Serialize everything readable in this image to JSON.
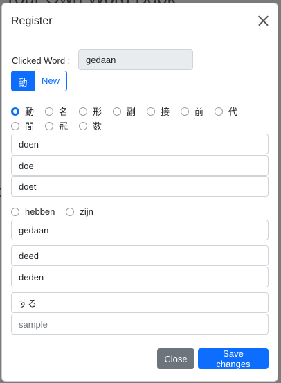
{
  "background": {
    "title_fragment": "Your Own Word Book",
    "side_fragment": "C"
  },
  "modal": {
    "title": "Register",
    "clicked_label": "Clicked Word :",
    "clicked_value": "gedaan",
    "buttons": {
      "active": "動",
      "new": "New"
    },
    "pos_row1": [
      {
        "label": "動",
        "checked": true
      },
      {
        "label": "名",
        "checked": false
      },
      {
        "label": "形",
        "checked": false
      },
      {
        "label": "副",
        "checked": false
      },
      {
        "label": "接",
        "checked": false
      },
      {
        "label": "前",
        "checked": false
      },
      {
        "label": "代",
        "checked": false
      }
    ],
    "pos_row2": [
      {
        "label": "間",
        "checked": false
      },
      {
        "label": "冠",
        "checked": false
      },
      {
        "label": "数",
        "checked": false
      }
    ],
    "fields": {
      "infinitive": "doen",
      "present_1": "doe",
      "present_2": "doet",
      "participle": "gedaan",
      "past_singular": "deed",
      "past_plural": "deden",
      "meaning": "する",
      "sample_value": "",
      "sample_placeholder": "sample"
    },
    "aux": {
      "hebben": "hebben",
      "zijn": "zijn"
    },
    "footer": {
      "close": "Close",
      "save": "Save changes"
    }
  },
  "colors": {
    "primary": "#0d6efd",
    "secondary": "#6c757d"
  }
}
